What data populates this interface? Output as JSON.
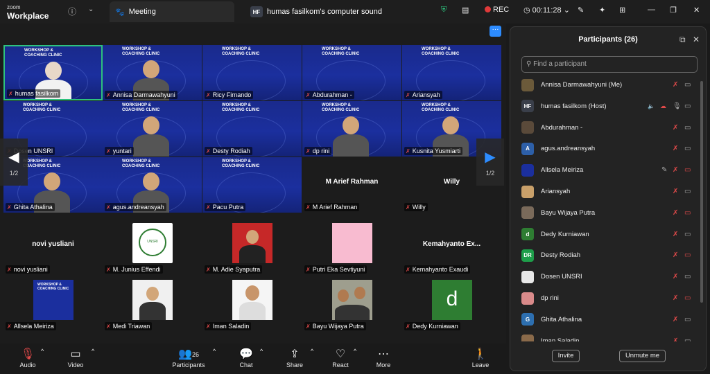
{
  "app": {
    "logo_line1": "zoom",
    "logo_line2": "Workplace"
  },
  "tabs": [
    {
      "label": "Meeting"
    },
    {
      "label": "humas fasilkom's computer sound",
      "badge": "HF"
    }
  ],
  "header": {
    "rec_label": "REC",
    "timer": "00:11:28"
  },
  "gallery": {
    "banner_title": "WORKSHOP &",
    "banner_title2": "COACHING CLINIC",
    "page_left": "1/2",
    "page_right": "1/2",
    "tiles": [
      {
        "name": "humas fasilkom"
      },
      {
        "name": "Annisa Darmawahyuni"
      },
      {
        "name": "Ricy Firnando"
      },
      {
        "name": "Abdurahman -"
      },
      {
        "name": "Ariansyah"
      },
      {
        "name": "Dosen UNSRI"
      },
      {
        "name": "yuntari"
      },
      {
        "name": "Desty Rodiah"
      },
      {
        "name": "dp rini"
      },
      {
        "name": "Kusnita Yusmiarti"
      },
      {
        "name": "Ghita Athalina"
      },
      {
        "name": "agus.andreansyah"
      },
      {
        "name": "Pacu Putra"
      },
      {
        "name": "M Arief Rahman",
        "big": "M Arief Rahman"
      },
      {
        "name": "Willy",
        "big": "Willy"
      },
      {
        "name": "novi yusliani",
        "big": "novi yusliani"
      },
      {
        "name": "M. Junius Effendi",
        "logo_text": "UNIVERSITAS SRIWIJAYA"
      },
      {
        "name": "M. Adie Syaputra"
      },
      {
        "name": "Putri Eka Sevtiyuni"
      },
      {
        "name": "Kemahyanto Exaudi",
        "big": "Kemahyanto  Ex..."
      },
      {
        "name": "Allsela Meiriza"
      },
      {
        "name": "Medi Triawan"
      },
      {
        "name": "Iman Saladin"
      },
      {
        "name": "Bayu Wijaya Putra"
      },
      {
        "name": "Dedy Kurniawan",
        "letter": "d"
      }
    ]
  },
  "toolbar": {
    "audio": "Audio",
    "video": "Video",
    "participants": "Participants",
    "participants_count": "26",
    "chat": "Chat",
    "share": "Share",
    "react": "React",
    "more": "More",
    "leave": "Leave"
  },
  "panel": {
    "title": "Participants (26)",
    "search_placeholder": "Find a participant",
    "invite": "Invite",
    "unmute": "Unmute me",
    "participants": [
      {
        "name": "Annisa Darmawahyuni (Me)",
        "avatar": "",
        "avcolor": "#6b5a3a"
      },
      {
        "name": "humas fasilkom (Host)",
        "avatar": "HF",
        "avcolor": "#3a3f4a"
      },
      {
        "name": "Abdurahman -",
        "avatar": "",
        "avcolor": "#5a4a3a"
      },
      {
        "name": "agus.andreansyah",
        "avatar": "A",
        "avcolor": "#2d5fa8"
      },
      {
        "name": "Allsela Meiriza",
        "avatar": "",
        "avcolor": "#1b2f9e"
      },
      {
        "name": "Ariansyah",
        "avatar": "",
        "avcolor": "#c9a06a"
      },
      {
        "name": "Bayu Wijaya Putra",
        "avatar": "",
        "avcolor": "#7a6a5a"
      },
      {
        "name": "Dedy Kurniawan",
        "avatar": "d",
        "avcolor": "#2e7d32"
      },
      {
        "name": "Desty Rodiah",
        "avatar": "DR",
        "avcolor": "#1e9e4a"
      },
      {
        "name": "Dosen UNSRI",
        "avatar": "",
        "avcolor": "#e8e8e8"
      },
      {
        "name": "dp rini",
        "avatar": "",
        "avcolor": "#d98a8a"
      },
      {
        "name": "Ghita Athalina",
        "avatar": "G",
        "avcolor": "#2d6fb0"
      },
      {
        "name": "Iman Saladin",
        "avatar": "",
        "avcolor": "#8a6a4a"
      }
    ]
  },
  "colors": {
    "accent": "#2d8cff",
    "muted_red": "#e24a4a",
    "banner_blue": "#1b2f9e",
    "active_border": "#2ec27e"
  }
}
